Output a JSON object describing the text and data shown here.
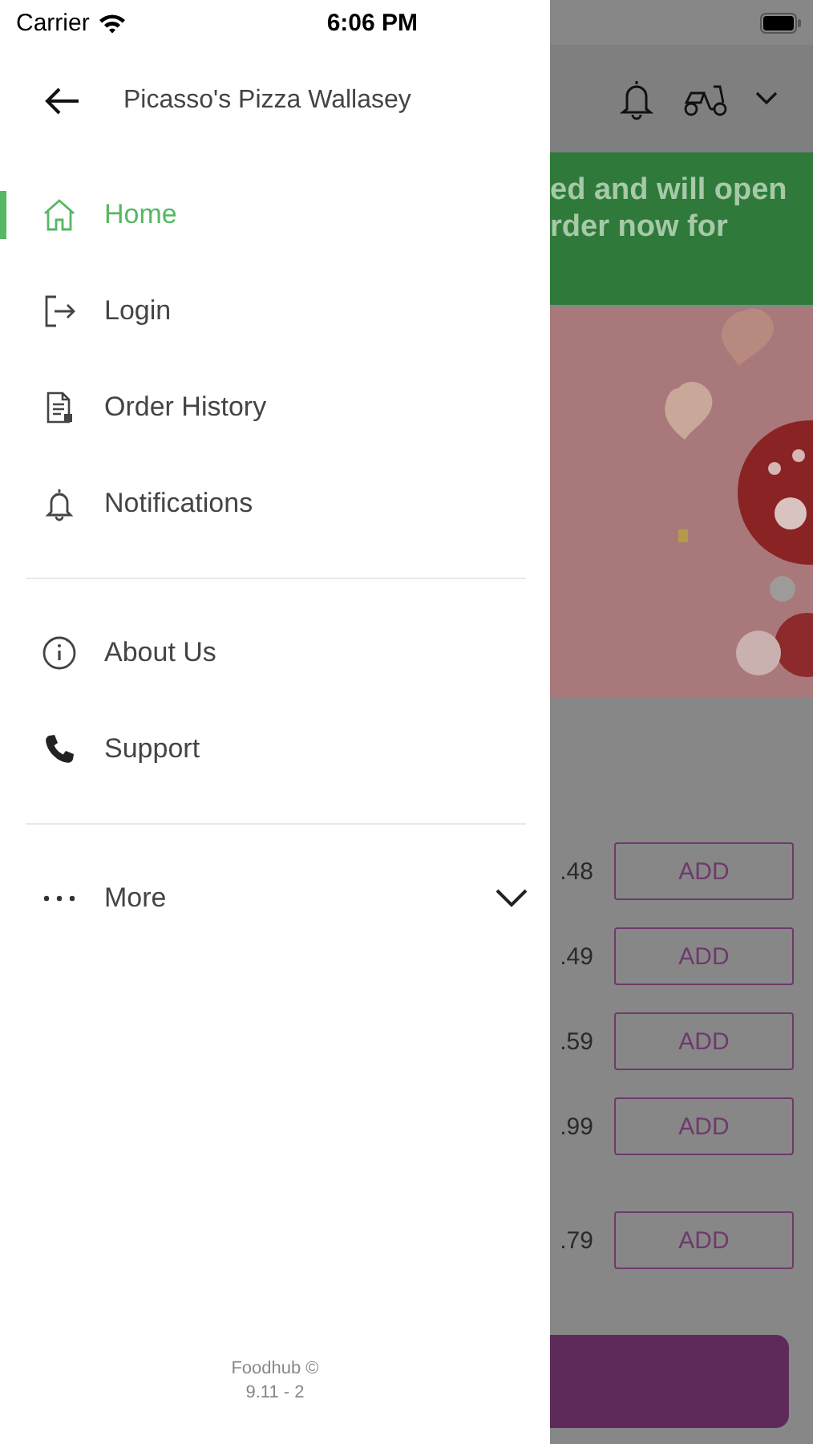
{
  "status_bar": {
    "carrier": "Carrier",
    "time": "6:06 PM"
  },
  "drawer": {
    "title": "Picasso's Pizza Wallasey",
    "sections": [
      {
        "items": [
          {
            "label": "Home",
            "kind": "home",
            "selected": true
          },
          {
            "label": "Login",
            "kind": "login",
            "selected": false
          },
          {
            "label": "Order History",
            "kind": "history",
            "selected": false
          },
          {
            "label": "Notifications",
            "kind": "bell",
            "selected": false
          }
        ]
      },
      {
        "items": [
          {
            "label": "About Us",
            "kind": "info",
            "selected": false
          },
          {
            "label": "Support",
            "kind": "phone",
            "selected": false
          }
        ]
      },
      {
        "items": [
          {
            "label": "More",
            "kind": "more",
            "selected": false,
            "expanded": false
          }
        ]
      }
    ],
    "footer": [
      "Foodhub ©",
      "9.11 - 2"
    ]
  },
  "background_page": {
    "banner_lines": [
      "ed and will open",
      "rder now for"
    ],
    "promo": {
      "kind": "picture"
    },
    "products": [
      {
        "price": ".48",
        "button": "ADD"
      },
      {
        "price": ".49",
        "button": "ADD"
      },
      {
        "price": ".59",
        "button": "ADD"
      },
      {
        "price": ".99",
        "button": "ADD"
      },
      {
        "price": ".79",
        "button": "ADD"
      }
    ]
  }
}
